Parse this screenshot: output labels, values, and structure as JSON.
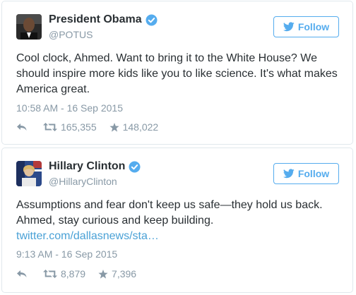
{
  "tweets": [
    {
      "name": "President Obama",
      "handle": "@POTUS",
      "follow_label": "Follow",
      "text": "Cool clock, Ahmed. Want to bring it to the White House? We should inspire more kids like you to like science. It's what makes America great.",
      "link": "",
      "timestamp": "10:58 AM - 16 Sep 2015",
      "retweets": "165,355",
      "favorites": "148,022"
    },
    {
      "name": "Hillary Clinton",
      "handle": "@HillaryClinton",
      "follow_label": "Follow",
      "text": "Assumptions and fear don't keep us safe—they hold us back. Ahmed, stay curious and keep building.",
      "link": "twitter.com/dallasnews/sta…",
      "timestamp": "9:13 AM - 16 Sep 2015",
      "retweets": "8,879",
      "favorites": "7,396"
    }
  ],
  "icons": {
    "verified": "verified-badge-icon",
    "bird": "twitter-bird-icon",
    "reply": "reply-arrow-icon",
    "retweet": "retweet-icon",
    "favorite": "star-icon"
  },
  "colors": {
    "accent": "#55acee",
    "link": "#4aa1d6",
    "muted": "#8899a6",
    "text": "#292f33",
    "border": "#e1e8ed"
  }
}
